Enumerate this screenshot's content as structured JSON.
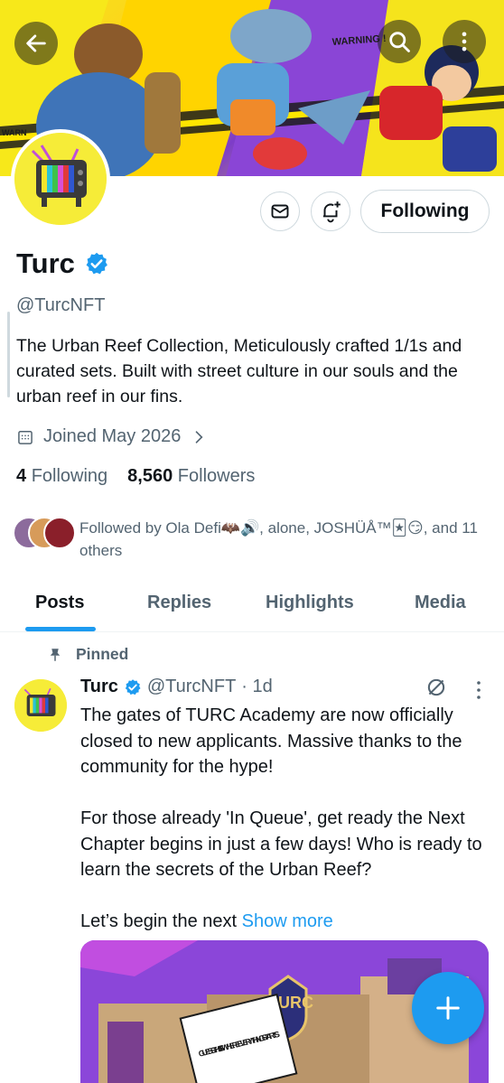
{
  "header": {
    "back_icon": "arrow-left-icon",
    "search_icon": "search-icon",
    "more_icon": "more-vertical-icon"
  },
  "banner": {
    "tape_text_1": "WARNING !",
    "tape_text_2": "WARN"
  },
  "profile": {
    "name": "Turc",
    "verified": true,
    "handle": "@TurcNFT",
    "bio": "The Urban Reef Collection, Meticulously crafted 1/1s and curated sets. Built with street culture in our souls and the urban reef in our fins.",
    "joined": "Joined May 2026",
    "following_count": "4",
    "following_label": "Following",
    "followers_count": "8,560",
    "followers_label": "Followers",
    "followed_by": "Followed by Ola Defi🦇🔊, alone, JOSHÜÅ™🃏😏, and 11 others",
    "follow_button_label": "Following"
  },
  "tabs": [
    {
      "label": "Posts",
      "active": true
    },
    {
      "label": "Replies",
      "active": false
    },
    {
      "label": "Highlights",
      "active": false
    },
    {
      "label": "Media",
      "active": false
    }
  ],
  "pinned_post": {
    "pinned_label": "Pinned",
    "author_name": "Turc",
    "author_handle": "@TurcNFT",
    "time": "· 1d",
    "body": "The gates of TURC Academy are now officially closed to new applicants. Massive thanks to the community for the hype!\n\nFor those already 'In Queue', get ready the Next Chapter begins in just a few days! Who is ready to learn the secrets of the Urban Reef?\n\nLet’s begin the next ",
    "show_more": "Show more",
    "media_text_1": "TURC",
    "media_text_2": "GUESS THIS IS WHERE EVERYTHING STARTS."
  },
  "colors": {
    "accent": "#1d9bf0",
    "text_primary": "#0f1419",
    "text_secondary": "#536471",
    "border": "#cfd9de"
  },
  "fab": {
    "icon": "plus-icon"
  }
}
